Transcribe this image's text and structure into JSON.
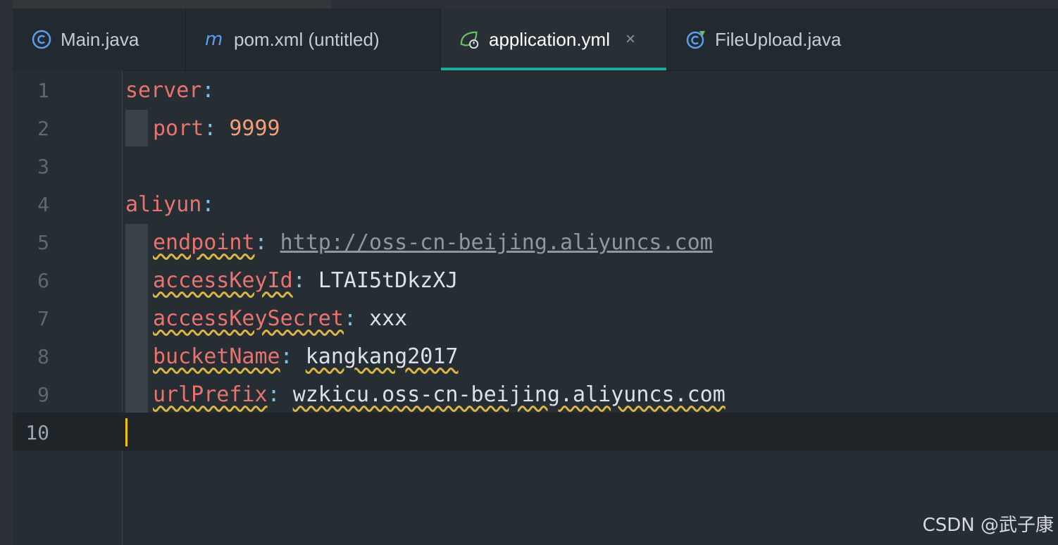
{
  "tabs": [
    {
      "label": "Main.java",
      "icon": "java-class-icon",
      "active": false
    },
    {
      "label": "pom.xml (untitled)",
      "icon": "maven-icon",
      "active": false
    },
    {
      "label": "application.yml",
      "icon": "spring-config-icon",
      "active": true,
      "close": "×"
    },
    {
      "label": "FileUpload.java",
      "icon": "spring-class-icon",
      "active": false
    }
  ],
  "line_numbers": [
    "1",
    "2",
    "3",
    "4",
    "5",
    "6",
    "7",
    "8",
    "9",
    "10"
  ],
  "code": {
    "l1_key": "server",
    "l1_colon": ":",
    "l2_key": "port",
    "l2_colon": ":",
    "l2_val": "9999",
    "l4_key": "aliyun",
    "l4_colon": ":",
    "l5_key": "endpoint",
    "l5_colon": ":",
    "l5_val": "http://oss-cn-beijing.aliyuncs.com",
    "l6_key": "accessKeyId",
    "l6_colon": ":",
    "l6_val": "LTAI5tDkzXJ",
    "l7_key": "accessKeySecret",
    "l7_colon": ":",
    "l7_val": "xxx",
    "l8_key": "bucketName",
    "l8_colon": ":",
    "l8_val": "kangkang2017",
    "l9_key": "urlPrefix",
    "l9_colon": ":",
    "l9_val": "wzkicu.oss-cn-beijing.aliyuncs.com"
  },
  "watermark": "CSDN @武子康",
  "colors": {
    "accent": "#1ea899",
    "key": "#e8736f",
    "number": "#f3a07a",
    "caret": "#f5c400"
  }
}
